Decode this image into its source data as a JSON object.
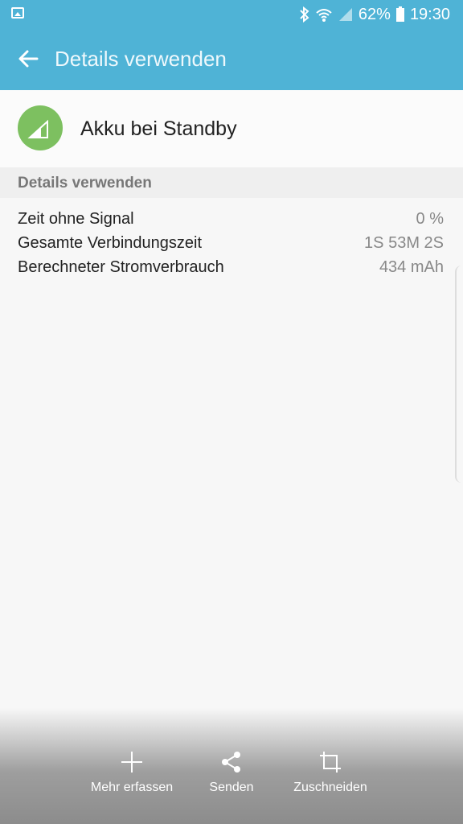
{
  "status_bar": {
    "battery_percent": "62%",
    "time": "19:30",
    "icons": [
      "gallery-icon",
      "bluetooth-icon",
      "wifi-icon",
      "signal-icon",
      "battery-icon"
    ]
  },
  "app_bar": {
    "title": "Details verwenden",
    "back_icon": "arrow-left-icon"
  },
  "header": {
    "title": "Akku bei Standby",
    "icon": "signal-icon",
    "icon_color": "#7dc060"
  },
  "section": {
    "title": "Details verwenden"
  },
  "details": [
    {
      "label": "Zeit ohne Signal",
      "value": "0 %"
    },
    {
      "label": "Gesamte Verbindungszeit",
      "value": "1S 53M 2S"
    },
    {
      "label": "Berechneter Stromverbrauch",
      "value": "434 mAh"
    }
  ],
  "actions": [
    {
      "label": "Mehr erfassen",
      "icon": "plus-icon"
    },
    {
      "label": "Senden",
      "icon": "share-icon"
    },
    {
      "label": "Zuschneiden",
      "icon": "crop-icon"
    }
  ],
  "colors": {
    "accent": "#4fb3d6"
  }
}
